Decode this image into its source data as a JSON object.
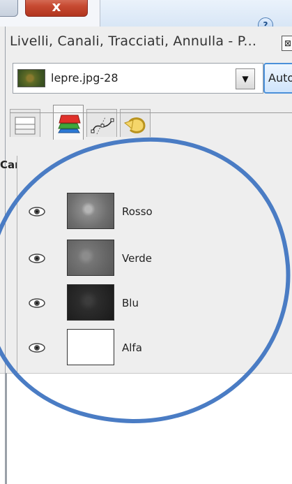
{
  "window": {
    "close_glyph": "x",
    "help_glyph": "?"
  },
  "dock": {
    "title": "Livelli, Canali, Tracciati, Annulla - P...",
    "close_glyph": "⊠"
  },
  "image_selector": {
    "name": "lepre.jpg-28",
    "arrow": "▼",
    "auto_label": "Auto"
  },
  "tabs": [
    {
      "icon": "layers-icon"
    },
    {
      "icon": "channels-icon",
      "active": true
    },
    {
      "icon": "paths-icon"
    },
    {
      "icon": "undo-history-icon"
    }
  ],
  "channels": {
    "header": "Canali",
    "menu_glyph": "◂",
    "items": [
      {
        "label": "Rosso",
        "visible": true,
        "tone": "#7a7a7a"
      },
      {
        "label": "Verde",
        "visible": true,
        "tone": "#6e6e6e"
      },
      {
        "label": "Blu",
        "visible": true,
        "tone": "#2e2e2e"
      },
      {
        "label": "Alfa",
        "visible": true,
        "tone": "#ffffff"
      }
    ]
  },
  "colors": {
    "annotation_circle": "#4a7cc4",
    "auto_button_border": "#4a90d9"
  }
}
